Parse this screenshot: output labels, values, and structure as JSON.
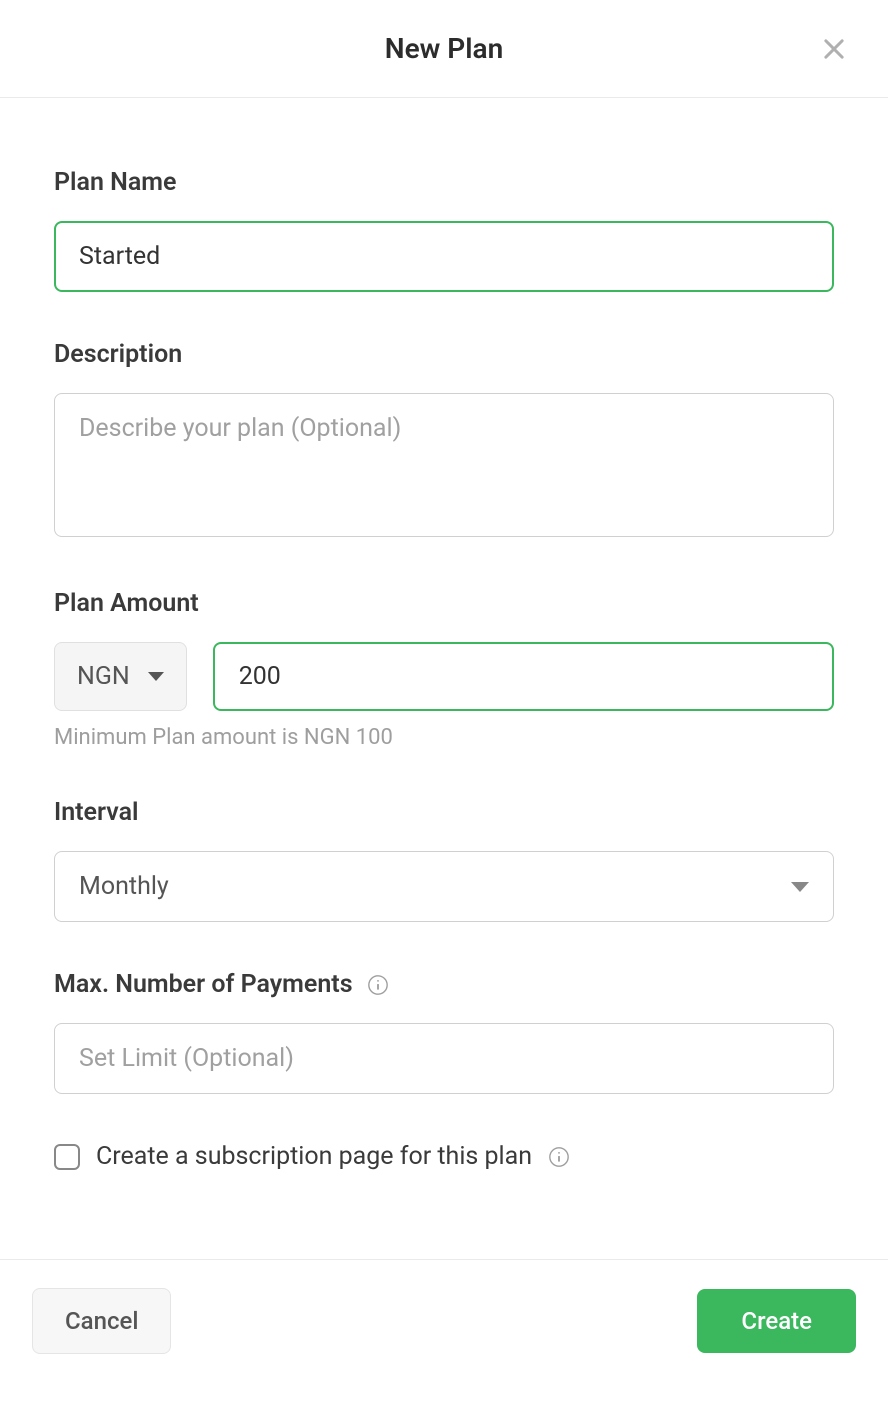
{
  "header": {
    "title": "New Plan"
  },
  "form": {
    "planName": {
      "label": "Plan Name",
      "value": "Started"
    },
    "description": {
      "label": "Description",
      "placeholder": "Describe your plan (Optional)",
      "value": ""
    },
    "planAmount": {
      "label": "Plan Amount",
      "currency": "NGN",
      "value": "200",
      "helper": "Minimum Plan amount is NGN 100"
    },
    "interval": {
      "label": "Interval",
      "value": "Monthly"
    },
    "maxPayments": {
      "label": "Max. Number of Payments",
      "placeholder": "Set Limit (Optional)",
      "value": ""
    },
    "subscriptionPage": {
      "label": "Create a subscription page for this plan",
      "checked": false
    }
  },
  "footer": {
    "cancel": "Cancel",
    "create": "Create"
  }
}
